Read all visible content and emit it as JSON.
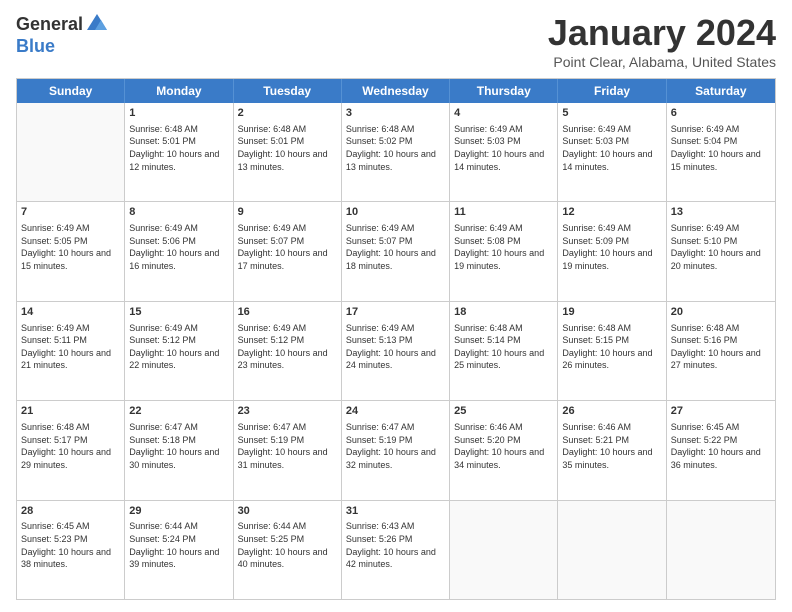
{
  "logo": {
    "general": "General",
    "blue": "Blue"
  },
  "title": "January 2024",
  "subtitle": "Point Clear, Alabama, United States",
  "headers": [
    "Sunday",
    "Monday",
    "Tuesday",
    "Wednesday",
    "Thursday",
    "Friday",
    "Saturday"
  ],
  "weeks": [
    [
      {
        "day": "",
        "sunrise": "",
        "sunset": "",
        "daylight": "",
        "empty": true
      },
      {
        "day": "1",
        "sunrise": "6:48 AM",
        "sunset": "5:01 PM",
        "daylight": "10 hours and 12 minutes."
      },
      {
        "day": "2",
        "sunrise": "6:48 AM",
        "sunset": "5:01 PM",
        "daylight": "10 hours and 13 minutes."
      },
      {
        "day": "3",
        "sunrise": "6:48 AM",
        "sunset": "5:02 PM",
        "daylight": "10 hours and 13 minutes."
      },
      {
        "day": "4",
        "sunrise": "6:49 AM",
        "sunset": "5:03 PM",
        "daylight": "10 hours and 14 minutes."
      },
      {
        "day": "5",
        "sunrise": "6:49 AM",
        "sunset": "5:03 PM",
        "daylight": "10 hours and 14 minutes."
      },
      {
        "day": "6",
        "sunrise": "6:49 AM",
        "sunset": "5:04 PM",
        "daylight": "10 hours and 15 minutes."
      }
    ],
    [
      {
        "day": "7",
        "sunrise": "6:49 AM",
        "sunset": "5:05 PM",
        "daylight": "10 hours and 15 minutes."
      },
      {
        "day": "8",
        "sunrise": "6:49 AM",
        "sunset": "5:06 PM",
        "daylight": "10 hours and 16 minutes."
      },
      {
        "day": "9",
        "sunrise": "6:49 AM",
        "sunset": "5:07 PM",
        "daylight": "10 hours and 17 minutes."
      },
      {
        "day": "10",
        "sunrise": "6:49 AM",
        "sunset": "5:07 PM",
        "daylight": "10 hours and 18 minutes."
      },
      {
        "day": "11",
        "sunrise": "6:49 AM",
        "sunset": "5:08 PM",
        "daylight": "10 hours and 19 minutes."
      },
      {
        "day": "12",
        "sunrise": "6:49 AM",
        "sunset": "5:09 PM",
        "daylight": "10 hours and 19 minutes."
      },
      {
        "day": "13",
        "sunrise": "6:49 AM",
        "sunset": "5:10 PM",
        "daylight": "10 hours and 20 minutes."
      }
    ],
    [
      {
        "day": "14",
        "sunrise": "6:49 AM",
        "sunset": "5:11 PM",
        "daylight": "10 hours and 21 minutes."
      },
      {
        "day": "15",
        "sunrise": "6:49 AM",
        "sunset": "5:12 PM",
        "daylight": "10 hours and 22 minutes."
      },
      {
        "day": "16",
        "sunrise": "6:49 AM",
        "sunset": "5:12 PM",
        "daylight": "10 hours and 23 minutes."
      },
      {
        "day": "17",
        "sunrise": "6:49 AM",
        "sunset": "5:13 PM",
        "daylight": "10 hours and 24 minutes."
      },
      {
        "day": "18",
        "sunrise": "6:48 AM",
        "sunset": "5:14 PM",
        "daylight": "10 hours and 25 minutes."
      },
      {
        "day": "19",
        "sunrise": "6:48 AM",
        "sunset": "5:15 PM",
        "daylight": "10 hours and 26 minutes."
      },
      {
        "day": "20",
        "sunrise": "6:48 AM",
        "sunset": "5:16 PM",
        "daylight": "10 hours and 27 minutes."
      }
    ],
    [
      {
        "day": "21",
        "sunrise": "6:48 AM",
        "sunset": "5:17 PM",
        "daylight": "10 hours and 29 minutes."
      },
      {
        "day": "22",
        "sunrise": "6:47 AM",
        "sunset": "5:18 PM",
        "daylight": "10 hours and 30 minutes."
      },
      {
        "day": "23",
        "sunrise": "6:47 AM",
        "sunset": "5:19 PM",
        "daylight": "10 hours and 31 minutes."
      },
      {
        "day": "24",
        "sunrise": "6:47 AM",
        "sunset": "5:19 PM",
        "daylight": "10 hours and 32 minutes."
      },
      {
        "day": "25",
        "sunrise": "6:46 AM",
        "sunset": "5:20 PM",
        "daylight": "10 hours and 34 minutes."
      },
      {
        "day": "26",
        "sunrise": "6:46 AM",
        "sunset": "5:21 PM",
        "daylight": "10 hours and 35 minutes."
      },
      {
        "day": "27",
        "sunrise": "6:45 AM",
        "sunset": "5:22 PM",
        "daylight": "10 hours and 36 minutes."
      }
    ],
    [
      {
        "day": "28",
        "sunrise": "6:45 AM",
        "sunset": "5:23 PM",
        "daylight": "10 hours and 38 minutes."
      },
      {
        "day": "29",
        "sunrise": "6:44 AM",
        "sunset": "5:24 PM",
        "daylight": "10 hours and 39 minutes."
      },
      {
        "day": "30",
        "sunrise": "6:44 AM",
        "sunset": "5:25 PM",
        "daylight": "10 hours and 40 minutes."
      },
      {
        "day": "31",
        "sunrise": "6:43 AM",
        "sunset": "5:26 PM",
        "daylight": "10 hours and 42 minutes."
      },
      {
        "day": "",
        "sunrise": "",
        "sunset": "",
        "daylight": "",
        "empty": true
      },
      {
        "day": "",
        "sunrise": "",
        "sunset": "",
        "daylight": "",
        "empty": true
      },
      {
        "day": "",
        "sunrise": "",
        "sunset": "",
        "daylight": "",
        "empty": true
      }
    ]
  ],
  "labels": {
    "sunrise": "Sunrise:",
    "sunset": "Sunset:",
    "daylight": "Daylight:"
  }
}
